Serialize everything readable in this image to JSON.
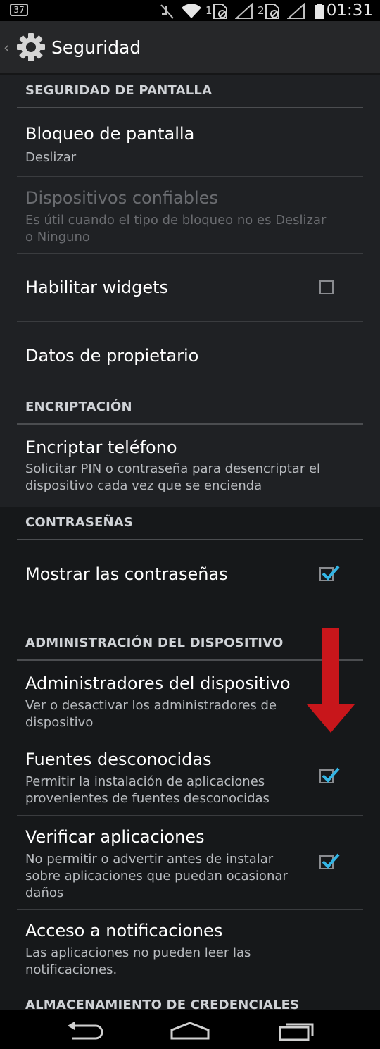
{
  "status_bar": {
    "notification_badge": "37",
    "sim1": "1",
    "sim2": "2",
    "time": "01:31"
  },
  "action_bar": {
    "title": "Seguridad",
    "icon": "gear-icon"
  },
  "sections": {
    "screen_security": {
      "header": "SEGURIDAD DE PANTALLA",
      "screen_lock": {
        "title": "Bloqueo de pantalla",
        "summary": "Deslizar"
      },
      "trusted_devices": {
        "title": "Dispositivos confiables",
        "summary": "Es útil cuando el tipo de bloqueo no es Deslizar o Ninguno"
      },
      "widgets": {
        "title": "Habilitar widgets",
        "checked": false
      },
      "owner_info": {
        "title": "Datos de propietario"
      }
    },
    "encryption": {
      "header": "ENCRIPTACIÓN",
      "encrypt_phone": {
        "title": "Encriptar teléfono",
        "summary": "Solicitar PIN o contraseña para desencriptar el dispositivo cada vez que se encienda"
      }
    },
    "passwords": {
      "header": "CONTRASEÑAS",
      "show_passwords": {
        "title": "Mostrar las contraseñas",
        "checked": true
      }
    },
    "device_admin": {
      "header": "ADMINISTRACIÓN DEL DISPOSITIVO",
      "device_admins": {
        "title": "Administradores del dispositivo",
        "summary": "Ver o desactivar los administradores de dispositivo"
      },
      "unknown_sources": {
        "title": "Fuentes desconocidas",
        "summary": "Permitir la instalación de aplicaciones provenientes de fuentes desconocidas",
        "checked": true
      },
      "verify_apps": {
        "title": "Verificar aplicaciones",
        "summary": "No permitir o advertir antes de instalar sobre aplicaciones que puedan ocasionar daños",
        "checked": true
      },
      "notification_access": {
        "title": "Acceso a notificaciones",
        "summary": "Las aplicaciones no pueden leer las notificaciones."
      }
    },
    "credential_storage": {
      "header": "ALMACENAMIENTO DE CREDENCIALES"
    }
  },
  "colors": {
    "background": "#1f2124",
    "checkmark": "#33b5e5",
    "annotation_arrow": "#c8161b"
  }
}
